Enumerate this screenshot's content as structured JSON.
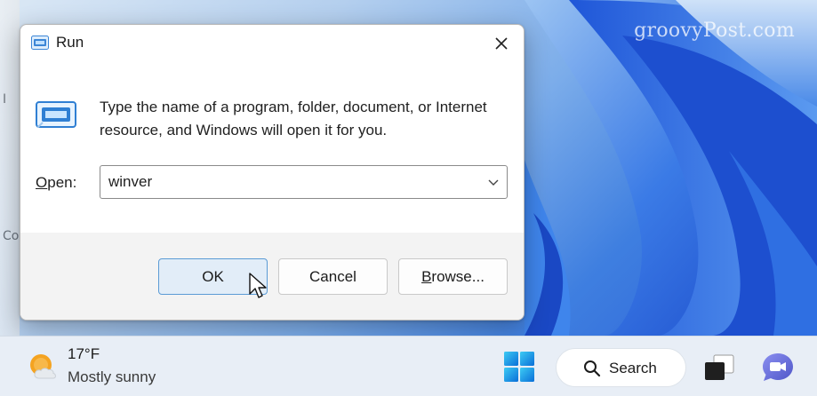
{
  "watermark": "groovyPost.com",
  "desktop": {
    "edge_glyphs": [
      "I",
      "Co"
    ]
  },
  "dialog": {
    "title": "Run",
    "icon": "run-app-icon",
    "close_icon": "close-icon",
    "message": "Type the name of a program, folder, document, or Internet resource, and Windows will open it for you.",
    "open_label_underlined": "O",
    "open_label_rest": "pen:",
    "open_value": "winver",
    "buttons": {
      "ok": "OK",
      "cancel": "Cancel",
      "browse_underlined": "B",
      "browse_rest": "rowse..."
    }
  },
  "taskbar": {
    "weather": {
      "temp": "17°F",
      "desc": "Mostly sunny",
      "icon": "partly-sunny-icon"
    },
    "search_label": "Search",
    "icons": [
      "windows-start-icon",
      "search-icon",
      "task-view-icon",
      "teams-chat-icon"
    ]
  },
  "colors": {
    "accent": "#0067c0",
    "ok_border": "#5b9bd5",
    "wallpaper_blue": "#2a5fd6",
    "taskbar_bg": "#e8eef6"
  }
}
